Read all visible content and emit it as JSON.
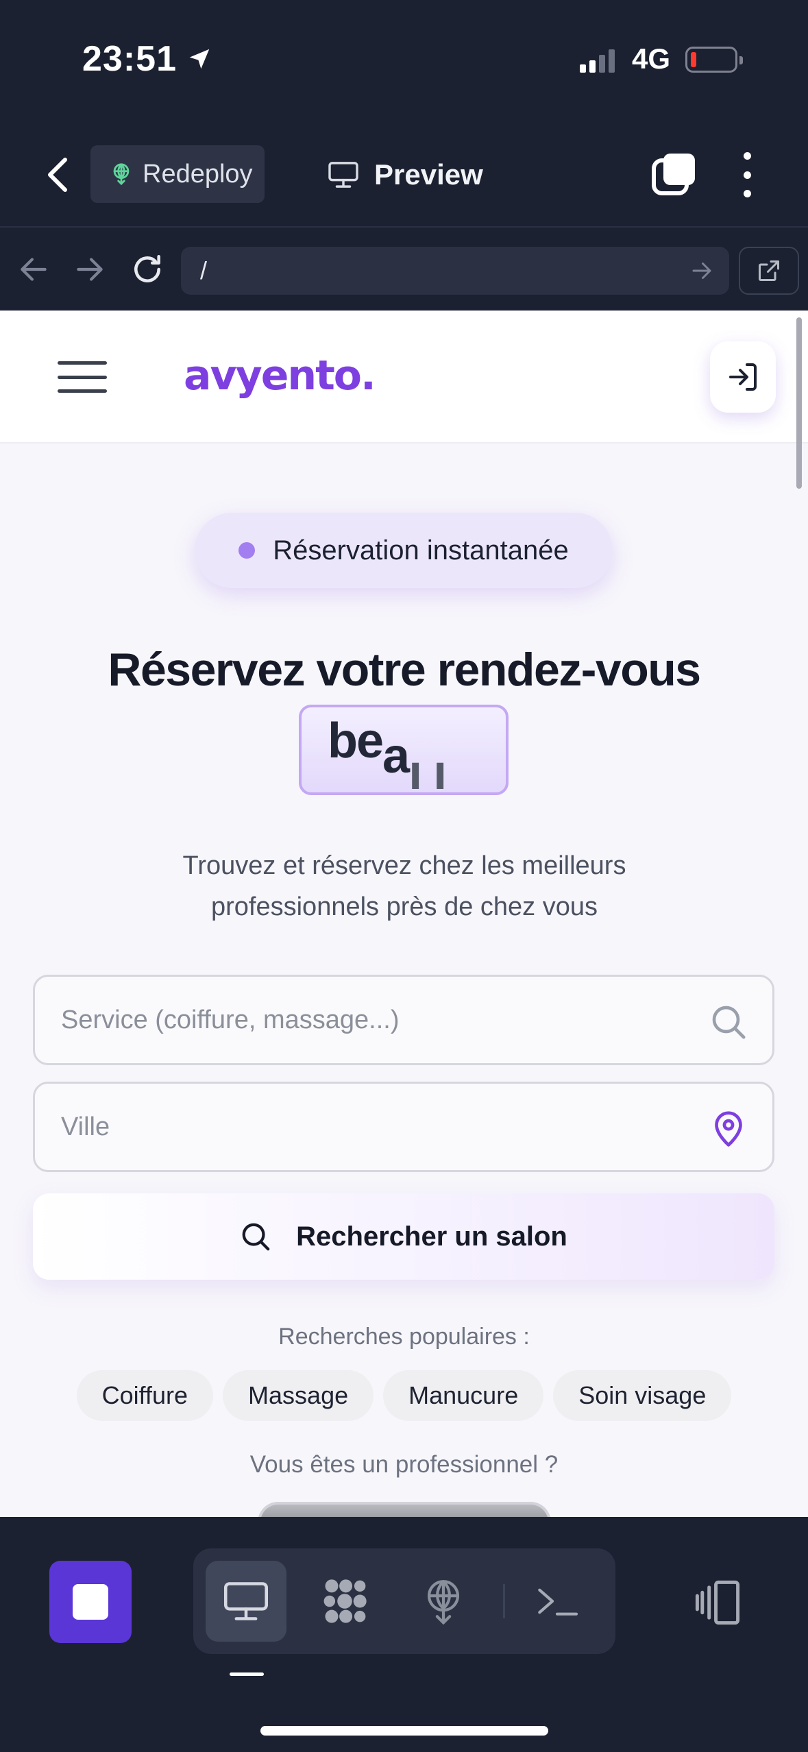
{
  "status_bar": {
    "time": "23:51",
    "network": "4G",
    "battery_color": "#ff3b30"
  },
  "toolbar": {
    "redeploy_label": "Redeploy",
    "preview_label": "Preview"
  },
  "urlbar": {
    "url": "/"
  },
  "site": {
    "logo": "avyento.",
    "brand_color": "#7e3fe0",
    "badge_label": "Réservation instantanée",
    "hero_title": "Réservez votre rendez-vous",
    "typed_main": "be",
    "typed_a": "a",
    "typed_rest": "ı ı",
    "subtitle_line1": "Trouvez et réservez chez les meilleurs",
    "subtitle_line2": "professionnels près de chez vous",
    "service_placeholder": "Service (coiffure, massage...)",
    "city_placeholder": "Ville",
    "search_button": "Rechercher un salon",
    "popular_label": "Recherches populaires :",
    "chips": [
      "Coiffure",
      "Massage",
      "Manucure",
      "Soin visage"
    ],
    "pro_label": "Vous êtes un professionnel ?"
  },
  "bottom_bar": {
    "accent": "#5a36d6",
    "tabs": [
      "monitor-icon",
      "apps-icon",
      "deploy-icon",
      "terminal-icon"
    ]
  }
}
